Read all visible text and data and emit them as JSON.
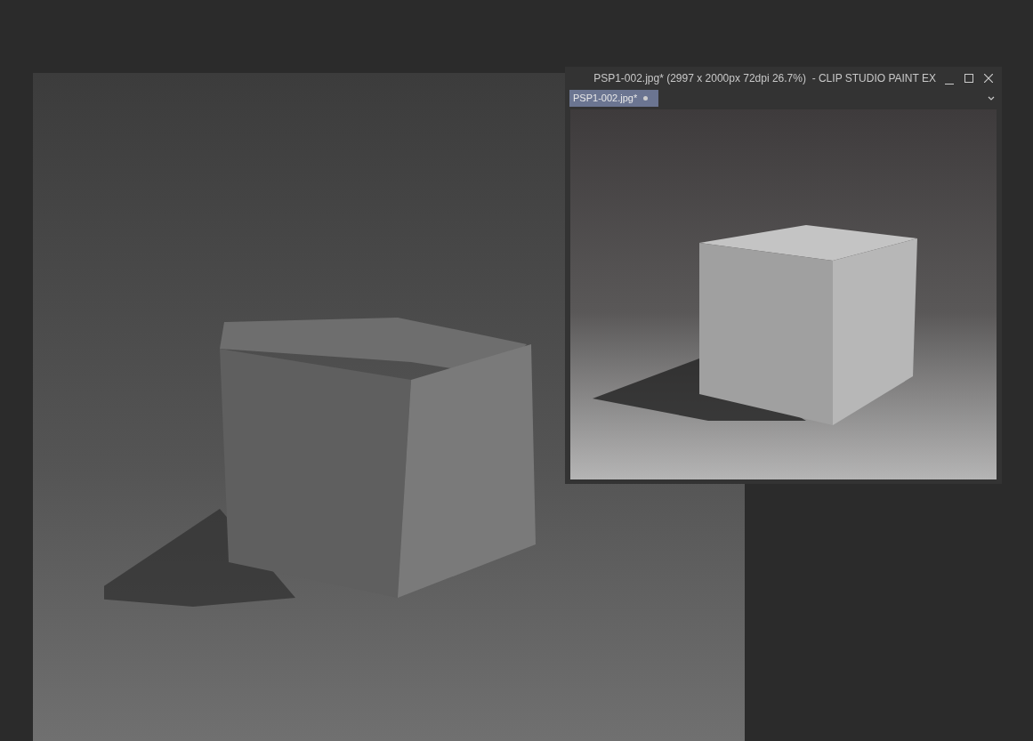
{
  "window": {
    "title": "PSP1-002.jpg* (2997 x 2000px 72dpi 26.7%)  - CLIP STUDIO PAINT EX"
  },
  "tabs": [
    {
      "label": "PSP1-002.jpg*",
      "selected": true
    }
  ]
}
